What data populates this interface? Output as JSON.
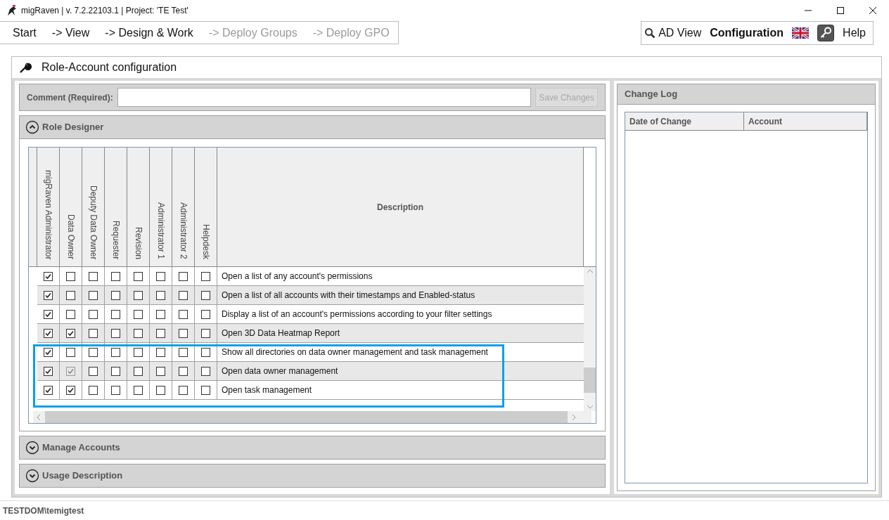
{
  "window": {
    "title": "migRaven | v. 7.2.22103.1 | Project: 'TE Test'"
  },
  "nav": [
    {
      "label": "Start",
      "disabled": false
    },
    {
      "label": "-> View",
      "disabled": false
    },
    {
      "label": "-> Design & Work",
      "disabled": false
    },
    {
      "label": "-> Deploy Groups",
      "disabled": true
    },
    {
      "label": "-> Deploy GPO",
      "disabled": true
    }
  ],
  "toolbar": [
    {
      "kind": "search",
      "label": "AD View",
      "selected": false
    },
    {
      "kind": "plain",
      "label": "Configuration",
      "selected": true
    },
    {
      "kind": "flag"
    },
    {
      "kind": "key"
    },
    {
      "kind": "plain",
      "label": "Help",
      "selected": false
    }
  ],
  "page_title": "Role-Account configuration",
  "comment": {
    "label": "Comment (Required):",
    "button": "Save Changes",
    "button_disabled": true
  },
  "sections": [
    {
      "title": "Role Designer",
      "expanded": true
    },
    {
      "title": "Manage Accounts",
      "expanded": false
    },
    {
      "title": "Usage Description",
      "expanded": false
    }
  ],
  "table": {
    "role_columns": [
      "migRaven Administrator",
      "Data Owner",
      "Deputy Data Owner",
      "Requester",
      "Revision",
      "Administrator 1",
      "Administrator 2",
      "Helpdesk"
    ],
    "description_column": "Description",
    "rows": [
      {
        "description": "Open a list of any account's permissions",
        "highlighted": false,
        "cells": [
          {
            "checked": true,
            "disabled": false
          },
          {
            "checked": false,
            "disabled": false
          },
          {
            "checked": false,
            "disabled": false
          },
          {
            "checked": false,
            "disabled": false
          },
          {
            "checked": false,
            "disabled": false
          },
          {
            "checked": false,
            "disabled": false
          },
          {
            "checked": false,
            "disabled": false
          },
          {
            "checked": false,
            "disabled": false
          }
        ]
      },
      {
        "description": "Open a list of all accounts with their timestamps and Enabled-status",
        "highlighted": false,
        "cells": [
          {
            "checked": true,
            "disabled": false
          },
          {
            "checked": false,
            "disabled": false
          },
          {
            "checked": false,
            "disabled": false
          },
          {
            "checked": false,
            "disabled": false
          },
          {
            "checked": false,
            "disabled": false
          },
          {
            "checked": false,
            "disabled": false
          },
          {
            "checked": false,
            "disabled": false
          },
          {
            "checked": false,
            "disabled": false
          }
        ]
      },
      {
        "description": "Display a list of an account's permissions according to your filter settings",
        "highlighted": false,
        "cells": [
          {
            "checked": true,
            "disabled": false
          },
          {
            "checked": false,
            "disabled": false
          },
          {
            "checked": false,
            "disabled": false
          },
          {
            "checked": false,
            "disabled": false
          },
          {
            "checked": false,
            "disabled": false
          },
          {
            "checked": false,
            "disabled": false
          },
          {
            "checked": false,
            "disabled": false
          },
          {
            "checked": false,
            "disabled": false
          }
        ]
      },
      {
        "description": "Open 3D Data Heatmap Report",
        "highlighted": false,
        "cells": [
          {
            "checked": true,
            "disabled": false
          },
          {
            "checked": true,
            "disabled": false
          },
          {
            "checked": false,
            "disabled": false
          },
          {
            "checked": false,
            "disabled": false
          },
          {
            "checked": false,
            "disabled": false
          },
          {
            "checked": false,
            "disabled": false
          },
          {
            "checked": false,
            "disabled": false
          },
          {
            "checked": false,
            "disabled": false
          }
        ]
      },
      {
        "description": "Show all directories on data owner management and task management",
        "highlighted": true,
        "cells": [
          {
            "checked": true,
            "disabled": false
          },
          {
            "checked": false,
            "disabled": false
          },
          {
            "checked": false,
            "disabled": false
          },
          {
            "checked": false,
            "disabled": false
          },
          {
            "checked": false,
            "disabled": false
          },
          {
            "checked": false,
            "disabled": false
          },
          {
            "checked": false,
            "disabled": false
          },
          {
            "checked": false,
            "disabled": false
          }
        ]
      },
      {
        "description": "Open data owner management",
        "highlighted": true,
        "cells": [
          {
            "checked": true,
            "disabled": false
          },
          {
            "checked": true,
            "disabled": true
          },
          {
            "checked": false,
            "disabled": false
          },
          {
            "checked": false,
            "disabled": false
          },
          {
            "checked": false,
            "disabled": false
          },
          {
            "checked": false,
            "disabled": false
          },
          {
            "checked": false,
            "disabled": false
          },
          {
            "checked": false,
            "disabled": false
          }
        ]
      },
      {
        "description": "Open task management",
        "highlighted": true,
        "cells": [
          {
            "checked": true,
            "disabled": false
          },
          {
            "checked": true,
            "disabled": false
          },
          {
            "checked": false,
            "disabled": false
          },
          {
            "checked": false,
            "disabled": false
          },
          {
            "checked": false,
            "disabled": false
          },
          {
            "checked": false,
            "disabled": false
          },
          {
            "checked": false,
            "disabled": false
          },
          {
            "checked": false,
            "disabled": false
          }
        ]
      }
    ]
  },
  "change_log": {
    "title": "Change Log",
    "columns": [
      "Date of Change",
      "Account"
    ]
  },
  "status_bar": "TESTDOM\\temigtest"
}
